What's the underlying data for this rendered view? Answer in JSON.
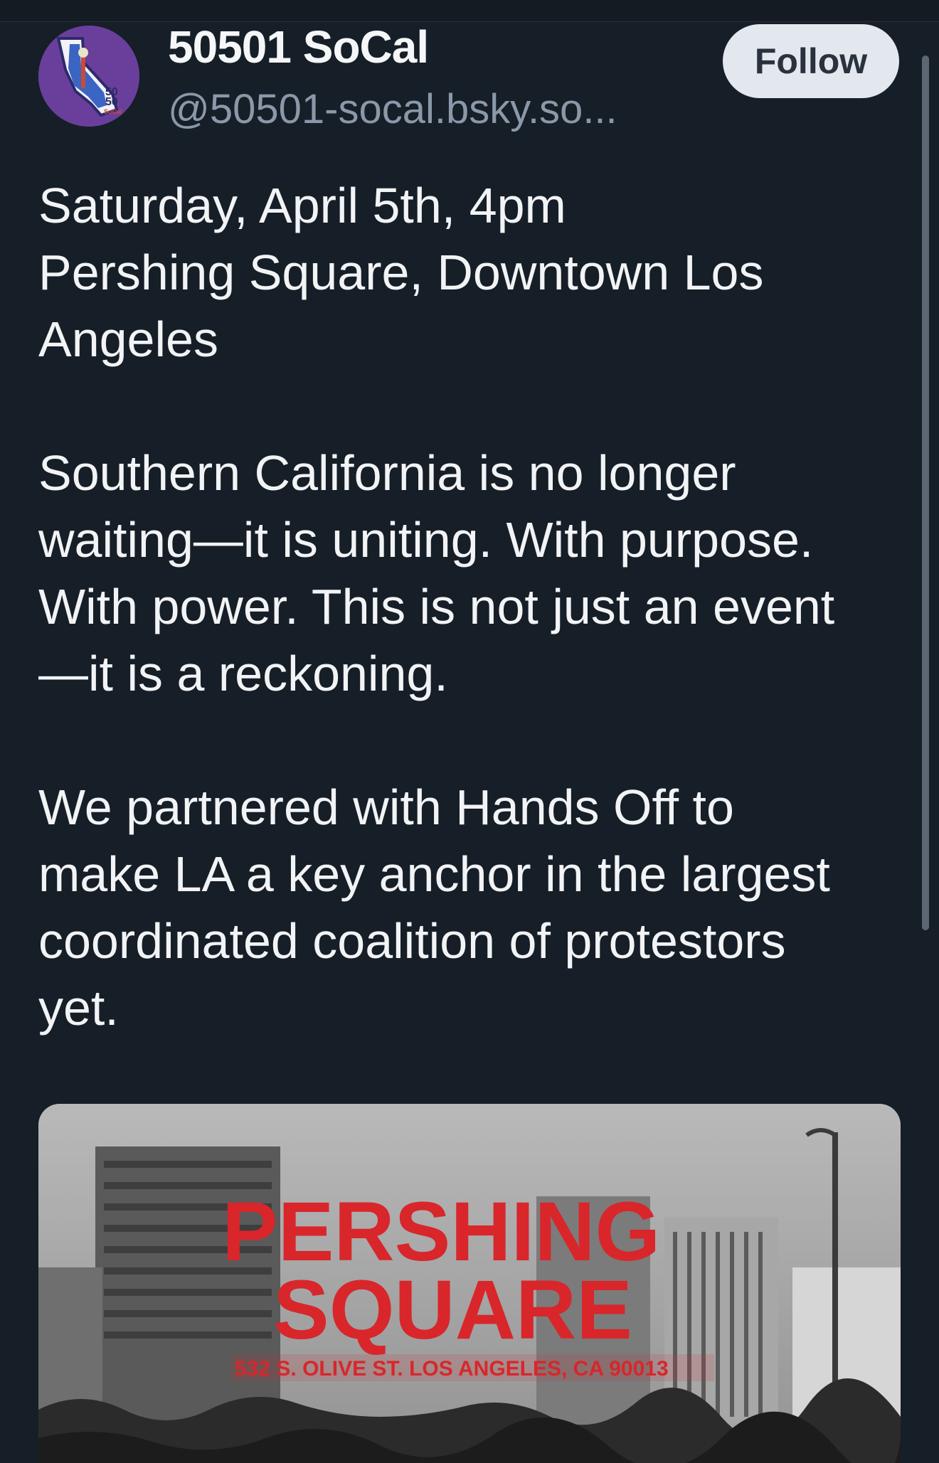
{
  "author": {
    "display_name": "50501 SoCal",
    "handle": "@50501-socal.bsky.so...",
    "avatar_text": "50 50 1 SoCal"
  },
  "follow_button": {
    "label": "Follow"
  },
  "post": {
    "paragraphs": [
      [
        "Saturday, April 5th, 4pm",
        "Pershing Square, Downtown Los",
        "Angeles"
      ],
      [
        "Southern California is no longer",
        "waiting—it is uniting. With purpose.",
        "With power. This is not just an event",
        "—it is a reckoning."
      ],
      [
        "We partnered with Hands Off to",
        "make LA a key anchor in the largest",
        "coordinated coalition of protestors",
        "yet."
      ]
    ]
  },
  "media": {
    "headline_line1": "PERSHING",
    "headline_line2": "SQUARE",
    "address": "532 S. OLIVE ST. LOS ANGELES, CA 90013",
    "headline_color": "#d8262b"
  },
  "colors": {
    "background": "#161e27",
    "text": "#f1f3f5",
    "handle": "#8a98a9",
    "follow_bg": "#e3e8ee",
    "avatar_bg": "#6a3f9c"
  }
}
